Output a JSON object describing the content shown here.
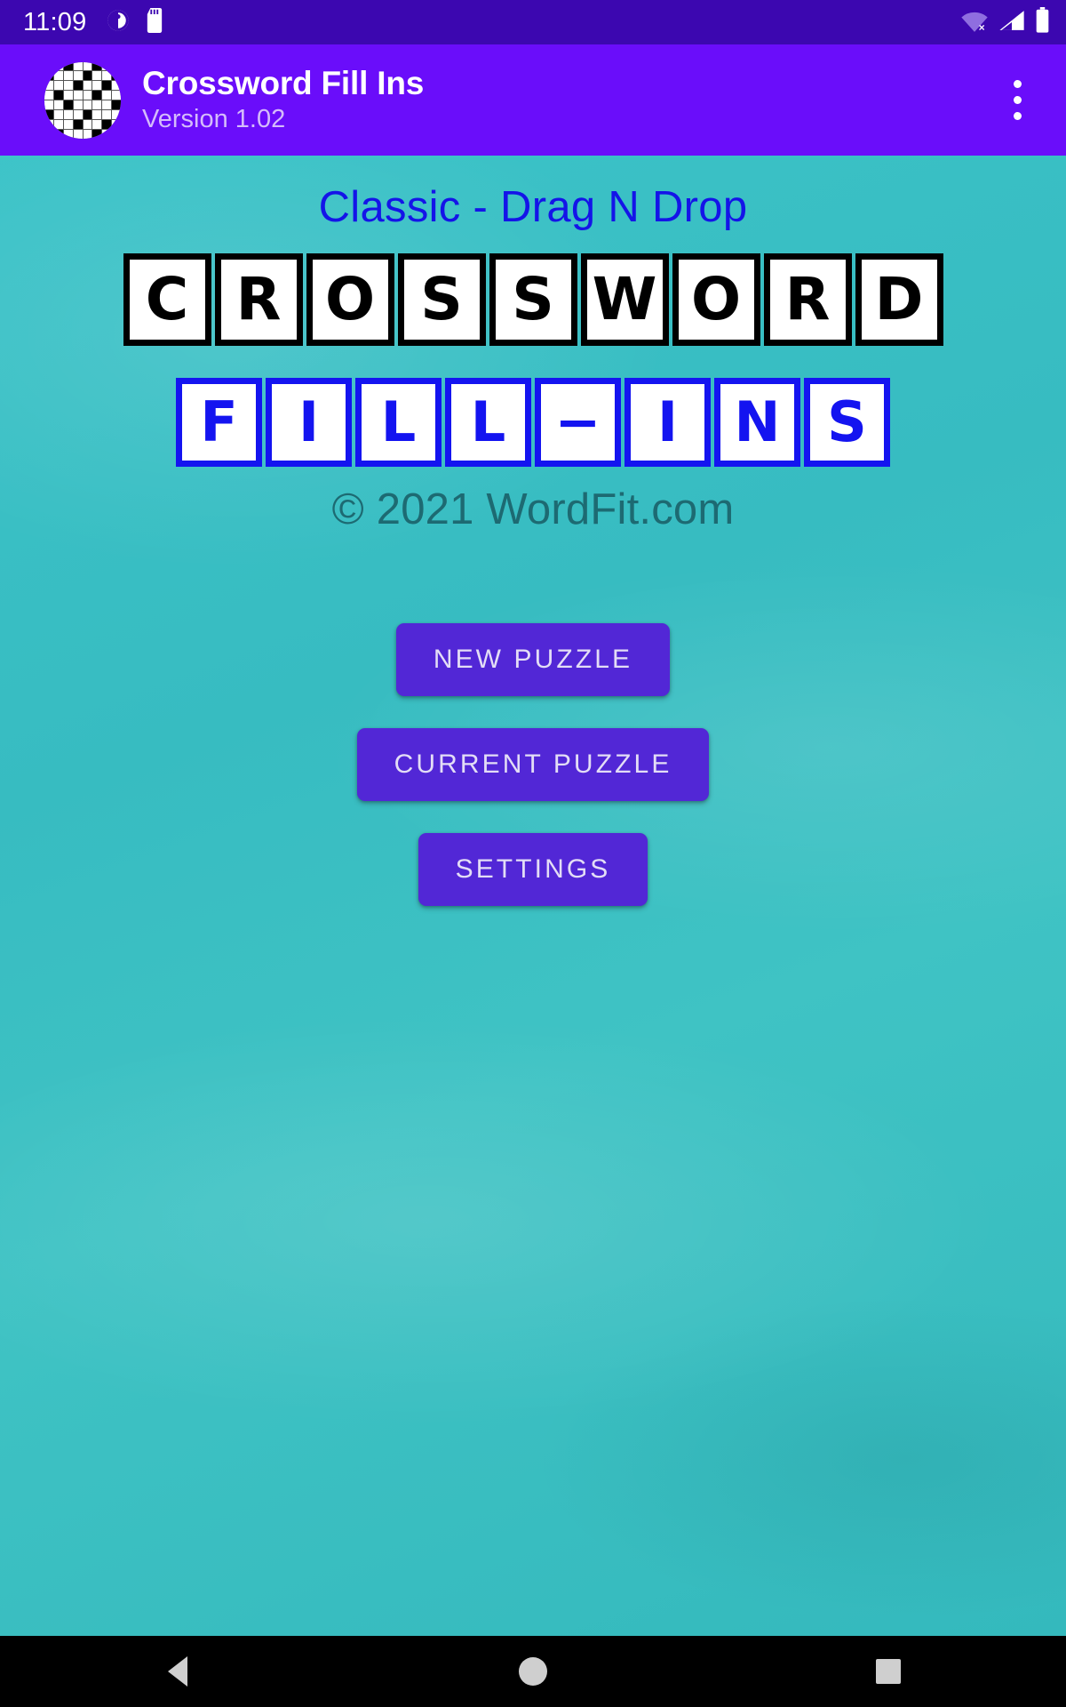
{
  "status_bar": {
    "time": "11:09",
    "icons_left": [
      "clock-app-icon",
      "sd-card-icon"
    ],
    "icons_right": [
      "wifi-off-icon",
      "cellular-signal-icon",
      "battery-icon"
    ],
    "background_color": "#3c07b0"
  },
  "app_bar": {
    "logo": "crossword-circle-logo",
    "title": "Crossword Fill Ins",
    "version": "Version 1.02",
    "overflow_icon": "more-vert-icon",
    "background_color": "#6a0dfa"
  },
  "main": {
    "page_title": "Classic - Drag N Drop",
    "title_color": "#1414e8",
    "background_color": "#3cc3c8",
    "word_row_1": {
      "letters": [
        "C",
        "R",
        "O",
        "S",
        "S",
        "W",
        "O",
        "R",
        "D"
      ],
      "border_color": "#000000",
      "text_color": "#000000"
    },
    "word_row_2": {
      "letters": [
        "F",
        "I",
        "L",
        "L",
        "−",
        "I",
        "N",
        "S"
      ],
      "border_color": "#1414f0",
      "text_color": "#1414f0"
    },
    "copyright": "© 2021 WordFit.com",
    "copyright_color": "#1d6a72",
    "buttons": [
      {
        "label": "NEW PUZZLE",
        "name": "new-puzzle-button"
      },
      {
        "label": "CURRENT PUZZLE",
        "name": "current-puzzle-button"
      },
      {
        "label": "SETTINGS",
        "name": "settings-button"
      }
    ],
    "button_color": "#5227d6",
    "button_text_color": "#e3ddf6"
  },
  "nav_bar": {
    "back": "back-triangle-icon",
    "home": "home-circle-icon",
    "recents": "recents-square-icon",
    "background_color": "#000000"
  }
}
